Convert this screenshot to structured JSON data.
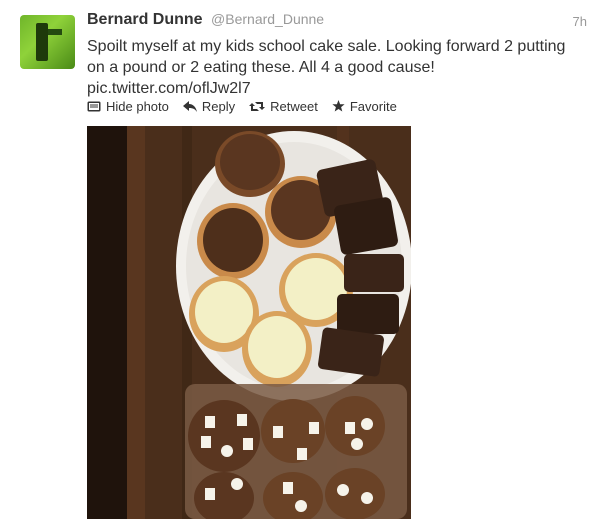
{
  "tweet": {
    "name": "Bernard Dunne",
    "handle": "@Bernard_Dunne",
    "time": "7h",
    "text_line1": "Spoilt myself at my kids school cake sale. Looking forward 2 putting",
    "text_line2": "on a pound or 2 eating these. All 4 a good cause!",
    "link": "pic.twitter.com/oflJw2l7"
  },
  "actions": {
    "hide_photo": "Hide photo",
    "reply": "Reply",
    "retweet": "Retweet",
    "favorite": "Favorite"
  },
  "icons": {
    "hide_photo": "photo-icon",
    "reply": "reply-arrow-icon",
    "retweet": "retweet-icon",
    "favorite": "star-icon"
  },
  "colors": {
    "text": "#333333",
    "muted": "#999999",
    "avatar_green": "#6fb52a"
  }
}
